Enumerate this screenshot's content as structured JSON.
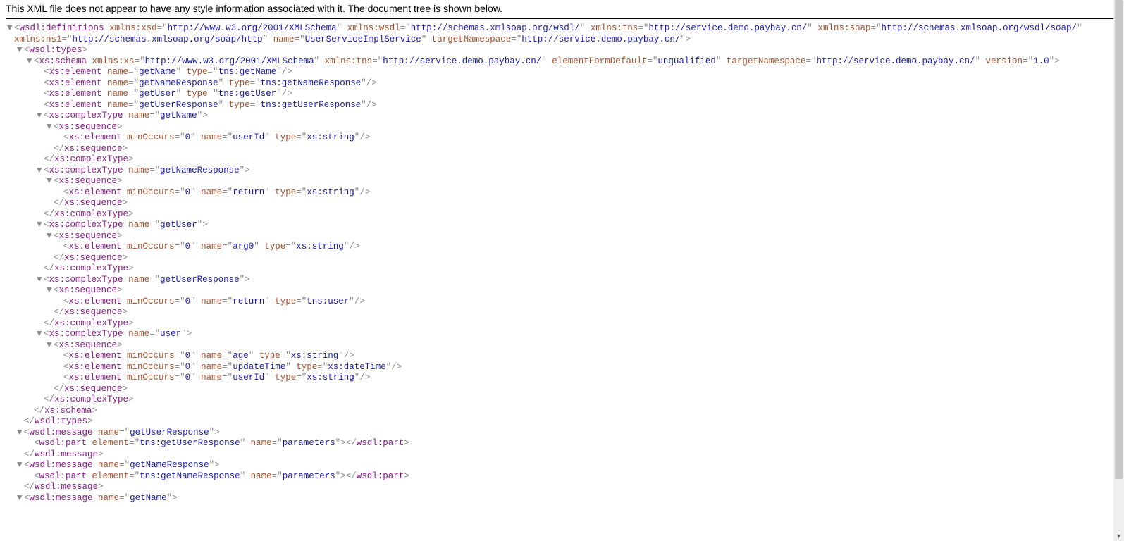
{
  "banner": "This XML file does not appear to have any style information associated with it. The document tree is shown below.",
  "q": "\"",
  "ns": {
    "xmlnsXsd": "xmlns:xsd",
    "xsdVal": "http://www.w3.org/2001/XMLSchema",
    "xmlnsWsdl": "xmlns:wsdl",
    "wsdlVal": "http://schemas.xmlsoap.org/wsdl/",
    "xmlnsTns": "xmlns:tns",
    "tnsVal": "http://service.demo.paybay.cn/",
    "xmlnsSoap": "xmlns:soap",
    "soapVal": "http://schemas.xmlsoap.org/wsdl/soap/",
    "xmlnsNs1": "xmlns:ns1",
    "ns1Val": "http://schemas.xmlsoap.org/soap/http",
    "name": "name",
    "svcName": "UserServiceImplService",
    "tns": "targetNamespace"
  },
  "schema": {
    "xmlnsXs": "xmlns:xs",
    "xsVal": "http://www.w3.org/2001/XMLSchema",
    "efd": "elementFormDefault",
    "efdVal": "unqualified",
    "ver": "version",
    "verVal": "1.0"
  },
  "attr": {
    "name": "name",
    "type": "type",
    "min": "minOccurs",
    "zero": "0",
    "element": "element"
  },
  "tags": {
    "wsdlDef": "wsdl:definitions",
    "wsdlTypes": "wsdl:types",
    "xsSchema": "xs:schema",
    "xsElement": "xs:element",
    "xsComplex": "xs:complexType",
    "xsSeq": "xs:sequence",
    "wsdlMsg": "wsdl:message",
    "wsdlPart": "wsdl:part"
  },
  "el": {
    "getName": "getName",
    "getNameT": "tns:getName",
    "getNameResp": "getNameResponse",
    "getNameRespT": "tns:getNameResponse",
    "getUser": "getUser",
    "getUserT": "tns:getUser",
    "getUserResp": "getUserResponse",
    "getUserRespT": "tns:getUserResponse",
    "userId": "userId",
    "xsString": "xs:string",
    "return": "return",
    "arg0": "arg0",
    "tnsUser": "tns:user",
    "user": "user",
    "age": "age",
    "updateTime": "updateTime",
    "xsDateTime": "xs:dateTime",
    "parameters": "parameters"
  }
}
